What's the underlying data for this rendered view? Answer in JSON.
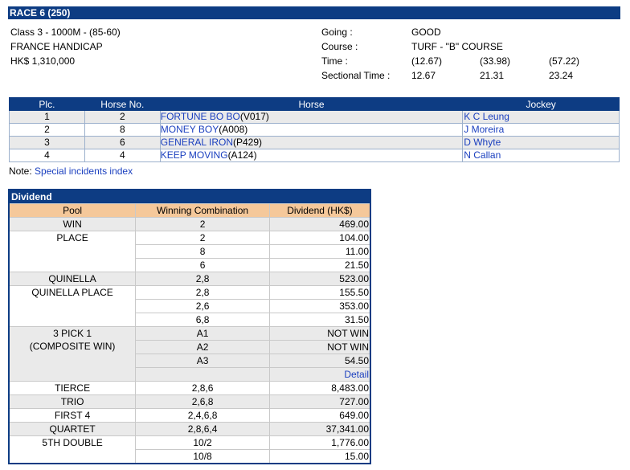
{
  "race": {
    "title": "RACE 6 (250)",
    "class_line": "Class 3 - 1000M - (85-60)",
    "name": "FRANCE HANDICAP",
    "prize": "HK$ 1,310,000",
    "going_label": "Going :",
    "going_value": "GOOD",
    "course_label": "Course :",
    "course_value": "TURF - \"B\" COURSE",
    "time_label": "Time :",
    "times": [
      "(12.67)",
      "(33.98)",
      "(57.22)"
    ],
    "sectional_label": "Sectional Time :",
    "sectionals": [
      "12.67",
      "21.31",
      "23.24"
    ]
  },
  "results": {
    "headers": [
      "Plc.",
      "Horse No.",
      "Horse",
      "Jockey"
    ],
    "rows": [
      {
        "plc": "1",
        "no": "2",
        "horse": "FORTUNE BO BO",
        "code": "(V017)",
        "jockey": "K C Leung"
      },
      {
        "plc": "2",
        "no": "8",
        "horse": "MONEY BOY",
        "code": "(A008)",
        "jockey": "J Moreira"
      },
      {
        "plc": "3",
        "no": "6",
        "horse": "GENERAL IRON",
        "code": "(P429)",
        "jockey": "D Whyte"
      },
      {
        "plc": "4",
        "no": "4",
        "horse": "KEEP MOVING",
        "code": "(A124)",
        "jockey": "N Callan"
      }
    ]
  },
  "note": {
    "label": "Note:",
    "link": "Special incidents index"
  },
  "dividend": {
    "title": "Dividend",
    "headers": [
      "Pool",
      "Winning Combination",
      "Dividend (HK$)"
    ],
    "win": {
      "pool": "WIN",
      "rows": [
        [
          "2",
          "469.00"
        ]
      ]
    },
    "place": {
      "pool": "PLACE",
      "rows": [
        [
          "2",
          "104.00"
        ],
        [
          "8",
          "11.00"
        ],
        [
          "6",
          "21.50"
        ]
      ]
    },
    "quinella": {
      "pool": "QUINELLA",
      "rows": [
        [
          "2,8",
          "523.00"
        ]
      ]
    },
    "quinella_place": {
      "pool": "QUINELLA PLACE",
      "rows": [
        [
          "2,8",
          "155.50"
        ],
        [
          "2,6",
          "353.00"
        ],
        [
          "6,8",
          "31.50"
        ]
      ]
    },
    "pick3": {
      "pool_line1": "3 PICK 1",
      "pool_line2": "(COMPOSITE WIN)",
      "rows": [
        [
          "A1",
          "NOT WIN"
        ],
        [
          "A2",
          "NOT WIN"
        ],
        [
          "A3",
          "54.50"
        ]
      ],
      "detail": "Detail"
    },
    "tierce": {
      "pool": "TIERCE",
      "rows": [
        [
          "2,8,6",
          "8,483.00"
        ]
      ]
    },
    "trio": {
      "pool": "TRIO",
      "rows": [
        [
          "2,6,8",
          "727.00"
        ]
      ]
    },
    "first4": {
      "pool": "FIRST 4",
      "rows": [
        [
          "2,4,6,8",
          "649.00"
        ]
      ]
    },
    "quartet": {
      "pool": "QUARTET",
      "rows": [
        [
          "2,8,6,4",
          "37,341.00"
        ]
      ]
    },
    "double5": {
      "pool": "5TH DOUBLE",
      "rows": [
        [
          "10/2",
          "1,776.00"
        ],
        [
          "10/8",
          "15.00"
        ]
      ]
    }
  }
}
